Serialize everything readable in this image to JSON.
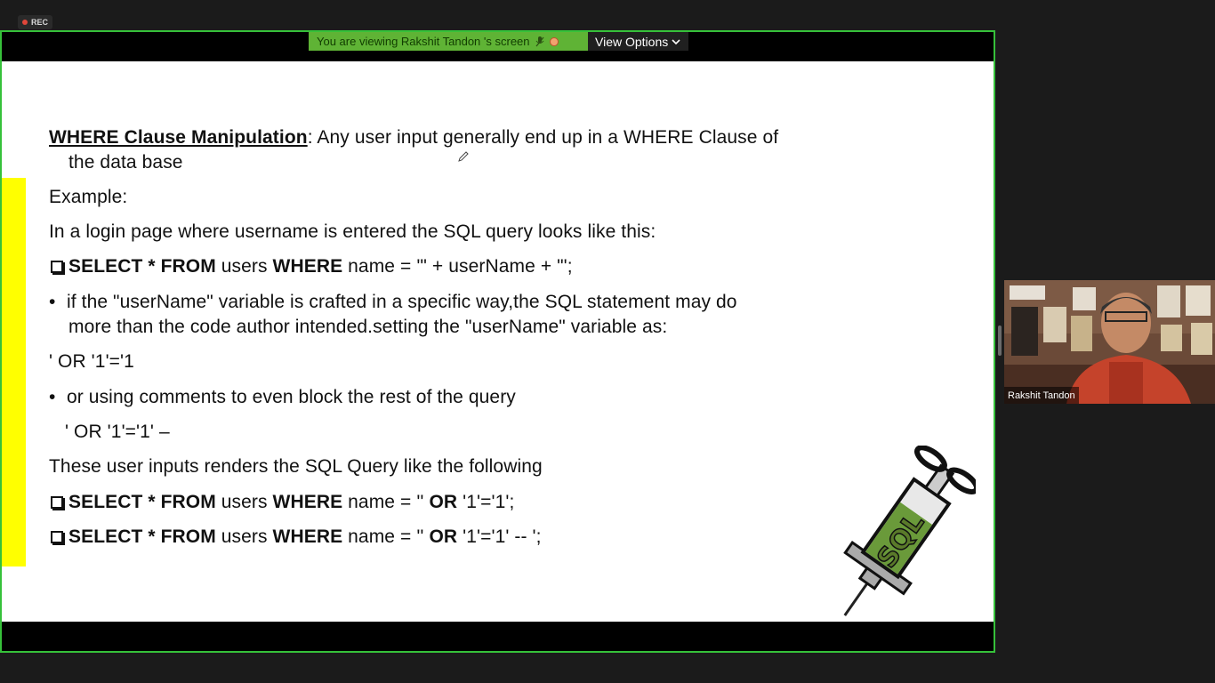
{
  "recording": {
    "label": "REC"
  },
  "share_banner": {
    "viewing_text": "You are viewing Rakshit Tandon 's screen",
    "view_options_label": "View Options",
    "view_options_chevron": "chevron-down-icon"
  },
  "slide": {
    "title": "WHERE Clause Manipulation",
    "title_rest": ": Any user input generally end up in a WHERE Clause of",
    "title_line2": "the data base",
    "example": "Example:",
    "intro": "In a login page where username is entered the SQL query looks like this:",
    "query1": {
      "kw_select": "SELECT * FROM",
      "table": " users ",
      "kw_where": "WHERE",
      "rest": " name = '\" + userName + \"';"
    },
    "bullet1_line1": "if the \"userName\" variable is crafted in a specific way,the SQL statement may do",
    "bullet1_line2": "more than the code author intended.setting the \"userName\" variable as:",
    "payload1": "' OR '1'='1",
    "bullet2": "or using comments to even block the rest of the query",
    "payload2": "' OR '1'='1' –",
    "renders_text": "These user inputs renders the SQL Query like the following",
    "query2": {
      "kw_select": "SELECT * FROM",
      "table": " users ",
      "kw_where": "WHERE",
      "mid": " name = '' ",
      "kw_or": "OR",
      "rest": " '1'='1';"
    },
    "query3": {
      "kw_select": "SELECT * FROM",
      "table": " users ",
      "kw_where": "WHERE",
      "mid": " name = '' ",
      "kw_or": "OR",
      "rest": " '1'='1' -- ';"
    },
    "syringe_label": "SQL",
    "accent_yellow": "#ffff00"
  },
  "participant": {
    "name": "Rakshit Tandon"
  },
  "colors": {
    "share_border": "#36c13a",
    "banner_bg": "#5fb335"
  }
}
